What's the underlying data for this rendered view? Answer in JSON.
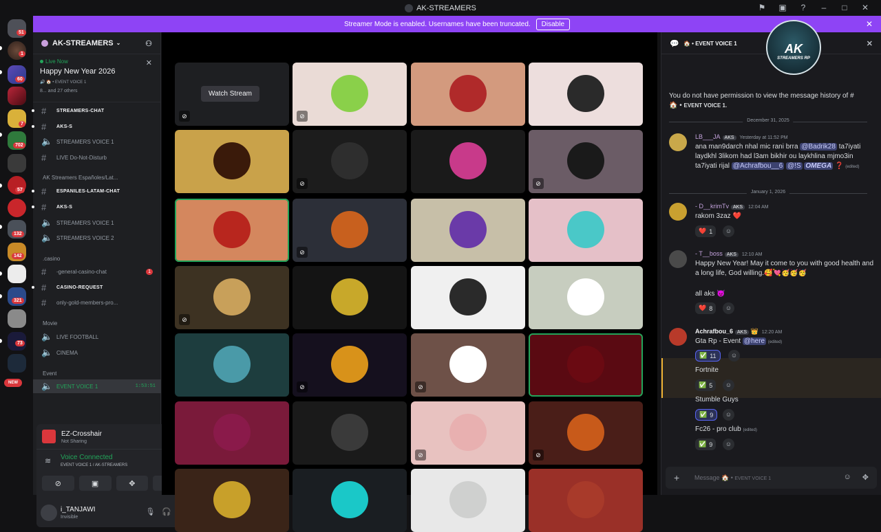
{
  "window": {
    "title": "AK-STREAMERS"
  },
  "banner": {
    "text": "Streamer Mode is enabled. Usernames have been truncated.",
    "button": "Disable"
  },
  "servers": {
    "badges": [
      "51",
      "1",
      "60",
      "7",
      "702",
      "57",
      "132",
      "142",
      "321",
      "73"
    ],
    "new_label": "NEW"
  },
  "guild": {
    "name": "AK-STREAMERS"
  },
  "live": {
    "status": "Live Now",
    "title": "Happy New Year 2026",
    "voice": "EVENT VOICE 1",
    "others": "8... and 27 others"
  },
  "channels": [
    {
      "label": "STREAMERS-CHAT",
      "type": "text",
      "bold": true
    },
    {
      "label": "AKS-S",
      "type": "text",
      "bold": true
    },
    {
      "label": "STREAMERS VOICE 1",
      "type": "voice",
      "bold": false
    },
    {
      "label": "LIVE Do-Not-Disturb",
      "type": "text",
      "bold": false
    },
    {
      "label": "AK Streamers Españoles/Lat...",
      "type": "category"
    },
    {
      "label": "ESPANILES-LATAM-CHAT",
      "type": "text",
      "bold": true
    },
    {
      "label": "AKS-S",
      "type": "text",
      "bold": true
    },
    {
      "label": "STREAMERS VOICE 1",
      "type": "voice",
      "bold": false
    },
    {
      "label": "STREAMERS VOICE 2",
      "type": "voice",
      "bold": false
    },
    {
      "label": ".casino",
      "type": "category"
    },
    {
      "label": "-general-casino-chat",
      "type": "text",
      "bold": false,
      "mention": "1"
    },
    {
      "label": "CASINO-REQUEST",
      "type": "text",
      "bold": true
    },
    {
      "label": "only-gold-members-pro...",
      "type": "text",
      "bold": false
    },
    {
      "label": "Movie",
      "type": "category"
    },
    {
      "label": "LIVE FOOTBALL",
      "type": "voice",
      "bold": false
    },
    {
      "label": "CINEMA",
      "type": "voice",
      "bold": false
    },
    {
      "label": "Event",
      "type": "category"
    },
    {
      "label": "EVENT VOICE 1",
      "type": "voice",
      "active": true,
      "timer": "1:53:51"
    }
  ],
  "userpanel": {
    "share_app": "EZ-Crosshair",
    "share_status": "Not Sharing",
    "voice_status": "Voice Connected",
    "voice_location": "EVENT VOICE 1 / AK-STREAMERS",
    "username": "i_TANJAWI",
    "user_status": "Invisible"
  },
  "grid": {
    "watch_label": "Watch Stream"
  },
  "chat": {
    "channel": "EVENT VOICE 1",
    "logo_big": "AK",
    "logo_small": "STREAMERS RP",
    "no_history_line1": "You do not have permission to view the message history of #",
    "no_history_line2": "EVENT VOICE 1.",
    "date1": "December 31, 2025",
    "date2": "January 1, 2026",
    "m1": {
      "user": "LB___JA",
      "tag": "AKS",
      "time": "Yesterday at 11:52 PM",
      "text1": "ana man9darch nhal mic rani brra ",
      "mention1": "@Badrik28",
      "text2": "ta7iyati laydkhl 3likom had l3am bikhir ou laykhlina mjmo3in ta7iyati rijal ",
      "mention2": "@Achrafbou__6",
      "mention3": "@!S",
      "text3": "OMEGA",
      "edited": "(edited)"
    },
    "m2": {
      "user": "- D__krimTv",
      "tag": "AKS",
      "time": "12:04 AM",
      "text": "rakom 3zaz",
      "react": "1"
    },
    "m3": {
      "user": "- T__boss",
      "tag": "AKS",
      "time": "12:10 AM",
      "text": "Happy New Year! May it come to you with good health and a long life, God willing.",
      "text2": "all aks",
      "react": "8"
    },
    "m4": {
      "user": "Achrafbou_6",
      "tag": "AKS",
      "time": "12:20 AM",
      "text": "Gta Rp - Event ",
      "mention": "@here",
      "edited": "(edited)",
      "r1": "11",
      "o2": "Fortnite",
      "r2": "5",
      "o3": "Stumble Guys",
      "r3": "9",
      "o4": "Fc26 - pro club",
      "o4edited": "(edited)",
      "r4": "9"
    },
    "composer_placeholder": "Message",
    "composer_channel": "EVENT VOICE 1"
  },
  "colors": {
    "accent": "#8e44f5",
    "online": "#23a55a",
    "danger": "#da373c"
  }
}
